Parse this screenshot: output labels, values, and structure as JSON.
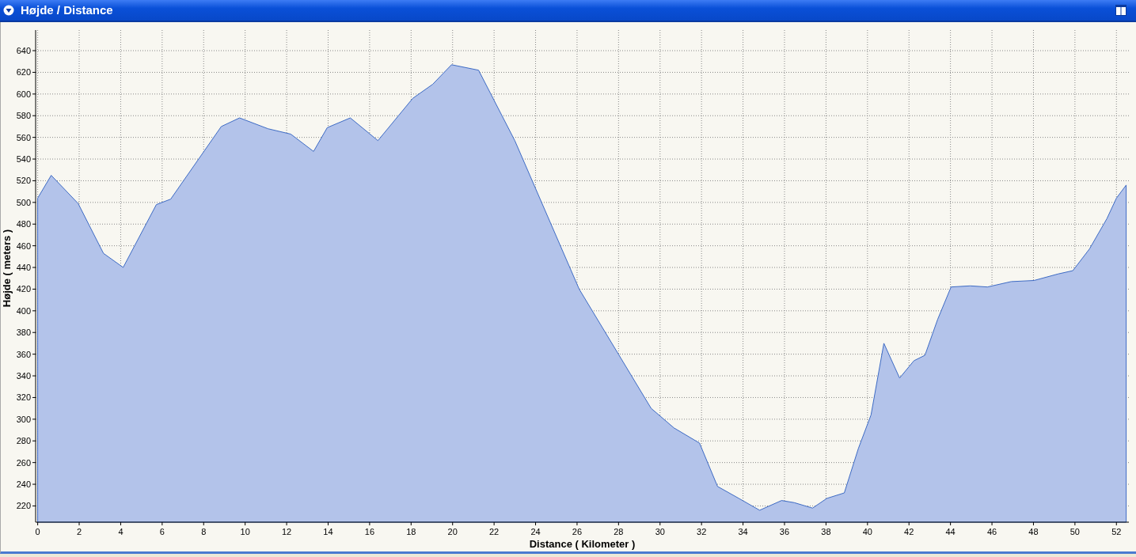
{
  "panel": {
    "title": "Højde / Distance"
  },
  "chart_data": {
    "type": "area",
    "xlabel": "Distance ( Kilometer )",
    "ylabel": "Højde ( meters )",
    "xlim": [
      -0.1,
      52.6
    ],
    "ylim": [
      205,
      659
    ],
    "xticks": [
      0,
      2,
      4,
      6,
      8,
      10,
      12,
      14,
      16,
      18,
      20,
      22,
      24,
      26,
      28,
      30,
      32,
      34,
      36,
      38,
      40,
      42,
      44,
      46,
      48,
      50,
      52
    ],
    "yticks": [
      220,
      240,
      260,
      280,
      300,
      320,
      340,
      360,
      380,
      400,
      420,
      440,
      460,
      480,
      500,
      520,
      540,
      560,
      580,
      600,
      620,
      640
    ],
    "x": [
      0,
      0.65,
      1.95,
      3.17,
      4.12,
      5.72,
      6.41,
      8.85,
      9.73,
      11.1,
      12.2,
      13.3,
      13.96,
      15.07,
      16.4,
      18.08,
      19.04,
      19.95,
      21.25,
      23.0,
      26.1,
      29.57,
      30.67,
      31.9,
      32.77,
      33.8,
      34.8,
      35.86,
      36.47,
      37.35,
      38.04,
      38.88,
      39.56,
      40.17,
      40.79,
      41.55,
      42.24,
      42.77,
      43.38,
      44.03,
      44.95,
      45.78,
      46.93,
      48.03,
      49.18,
      49.9,
      50.7,
      51.54,
      52.0,
      52.47
    ],
    "grid": true,
    "series": [
      {
        "color": "#3e6bc4",
        "values": [
          504,
          525,
          499,
          453,
          440,
          498,
          503,
          570,
          578,
          568,
          563,
          547,
          569,
          578,
          557,
          596,
          609,
          627,
          622,
          557,
          420,
          310,
          292,
          278,
          238,
          227,
          216,
          225,
          223,
          218,
          227,
          232,
          273,
          304,
          370,
          338,
          354,
          359,
          392,
          422,
          423,
          422,
          427,
          428,
          434,
          437,
          457,
          485,
          504,
          516
        ]
      }
    ]
  }
}
